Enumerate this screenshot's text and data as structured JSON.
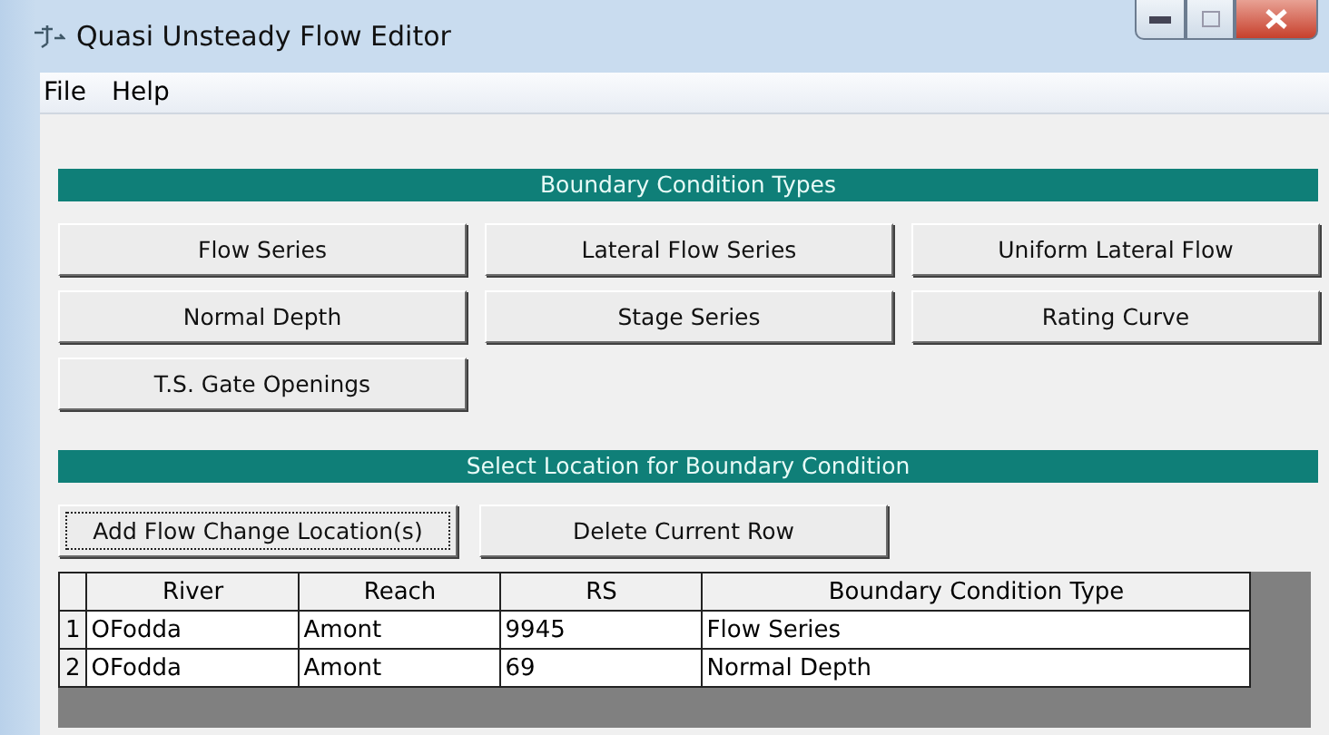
{
  "window": {
    "title": "Quasi Unsteady Flow Editor"
  },
  "menu": [
    "File",
    "Help"
  ],
  "boundary_types": {
    "title": "Boundary Condition Types",
    "buttons": [
      "Flow Series",
      "Lateral Flow Series",
      "Uniform Lateral Flow",
      "Normal Depth",
      "Stage Series",
      "Rating Curve",
      "T.S. Gate Openings"
    ]
  },
  "location": {
    "title": "Select Location for Boundary Condition",
    "buttons": [
      {
        "label": "Add Flow Change Location(s)",
        "focused": true
      },
      {
        "label": "Delete Current Row",
        "focused": false
      }
    ]
  },
  "table": {
    "columns": [
      "River",
      "Reach",
      "RS",
      "Boundary Condition Type"
    ],
    "rows": [
      {
        "number": "1",
        "cells": [
          "OFodda",
          "Amont",
          "9945",
          "Flow Series"
        ]
      },
      {
        "number": "2",
        "cells": [
          "OFodda",
          "Amont",
          "69",
          "Normal Depth"
        ]
      }
    ]
  }
}
